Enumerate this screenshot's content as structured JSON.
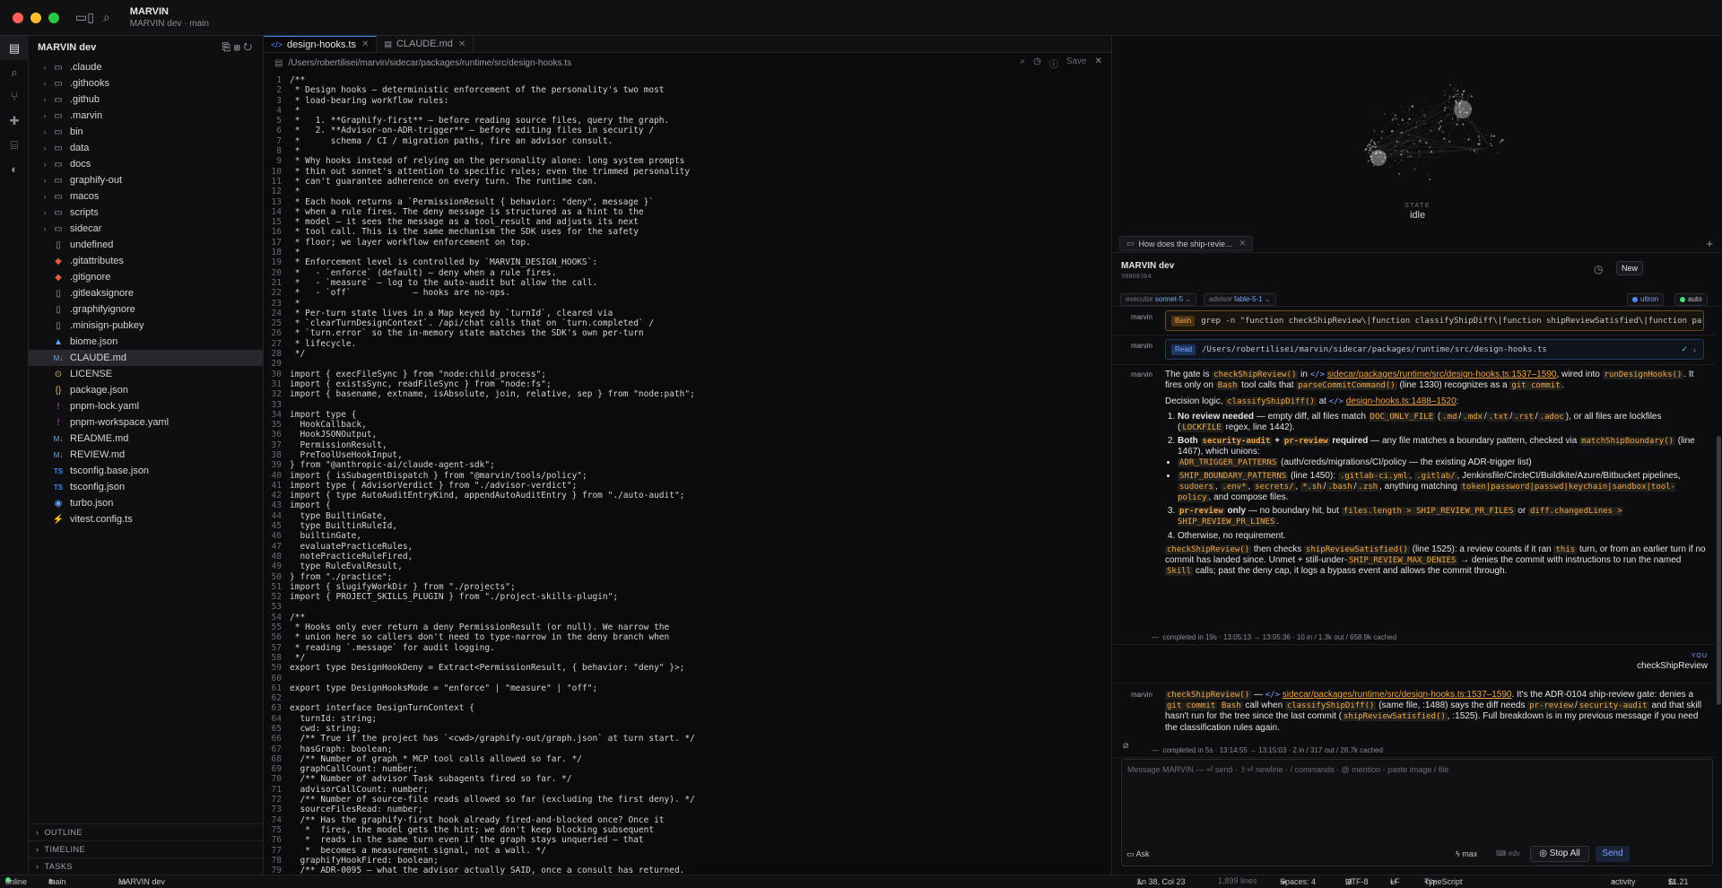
{
  "titlebar": {
    "title": "MARVIN",
    "subtitle": "MARVIN dev · main"
  },
  "explorer": {
    "title": "MARVIN dev",
    "items": [
      {
        "name": ".claude",
        "kind": "folder"
      },
      {
        "name": ".githooks",
        "kind": "folder"
      },
      {
        "name": ".github",
        "kind": "folder"
      },
      {
        "name": ".marvin",
        "kind": "folder"
      },
      {
        "name": "bin",
        "kind": "folder"
      },
      {
        "name": "data",
        "kind": "folder"
      },
      {
        "name": "docs",
        "kind": "folder"
      },
      {
        "name": "graphify-out",
        "kind": "folder"
      },
      {
        "name": "macos",
        "kind": "folder"
      },
      {
        "name": "scripts",
        "kind": "folder"
      },
      {
        "name": "sidecar",
        "kind": "folder"
      },
      {
        "name": "undefined",
        "kind": "file"
      },
      {
        "name": ".gitattributes",
        "kind": "git"
      },
      {
        "name": ".gitignore",
        "kind": "git"
      },
      {
        "name": ".gitleaksignore",
        "kind": "file"
      },
      {
        "name": ".graphifyignore",
        "kind": "file"
      },
      {
        "name": ".minisign-pubkey",
        "kind": "file"
      },
      {
        "name": "biome.json",
        "kind": "biome"
      },
      {
        "name": "CLAUDE.md",
        "kind": "md",
        "selected": true
      },
      {
        "name": "LICENSE",
        "kind": "lic"
      },
      {
        "name": "package.json",
        "kind": "json"
      },
      {
        "name": "pnpm-lock.yaml",
        "kind": "yaml"
      },
      {
        "name": "pnpm-workspace.yaml",
        "kind": "yaml"
      },
      {
        "name": "README.md",
        "kind": "md"
      },
      {
        "name": "REVIEW.md",
        "kind": "md"
      },
      {
        "name": "tsconfig.base.json",
        "kind": "ts"
      },
      {
        "name": "tsconfig.json",
        "kind": "ts"
      },
      {
        "name": "turbo.json",
        "kind": "turbo"
      },
      {
        "name": "vitest.config.ts",
        "kind": "vit"
      }
    ],
    "sections": [
      "OUTLINE",
      "TIMELINE",
      "TASKS"
    ]
  },
  "editor": {
    "tabs": [
      {
        "label": "design-hooks.ts"
      },
      {
        "label": "CLAUDE.md"
      }
    ],
    "path": "/Users/robertilisei/marvin/sidecar/packages/runtime/src/design-hooks.ts",
    "save_label": "Save",
    "lines": [
      "/**",
      " * Design hooks — deterministic enforcement of the personality's two most",
      " * load-bearing workflow rules:",
      " *",
      " *   1. **Graphify-first** — before reading source files, query the graph.",
      " *   2. **Advisor-on-ADR-trigger** — before editing files in security /",
      " *      schema / CI / migration paths, fire an advisor consult.",
      " *",
      " * Why hooks instead of relying on the personality alone: long system prompts",
      " * thin out sonnet's attention to specific rules; even the trimmed personality",
      " * can't guarantee adherence on every turn. The runtime can.",
      " *",
      " * Each hook returns a `PermissionResult { behavior: \"deny\", message }`",
      " * when a rule fires. The deny message is structured as a hint to the",
      " * model — it sees the message as a tool_result and adjusts its next",
      " * tool call. This is the same mechanism the SDK uses for the safety",
      " * floor; we layer workflow enforcement on top.",
      " *",
      " * Enforcement level is controlled by `MARVIN_DESIGN_HOOKS`:",
      " *   - `enforce` (default) — deny when a rule fires.",
      " *   - `measure` — log to the auto-audit but allow the call.",
      " *   - `off`            — hooks are no-ops.",
      " *",
      " * Per-turn state lives in a Map keyed by `turnId`, cleared via",
      " * `clearTurnDesignContext`. /api/chat calls that on `turn.completed` /",
      " * `turn.error` so the in-memory state matches the SDK's own per-turn",
      " * lifecycle.",
      " */",
      "",
      "import { execFileSync } from \"node:child_process\";",
      "import { existsSync, readFileSync } from \"node:fs\";",
      "import { basename, extname, isAbsolute, join, relative, sep } from \"node:path\";",
      "",
      "import type {",
      "  HookCallback,",
      "  HookJSONOutput,",
      "  PermissionResult,",
      "  PreToolUseHookInput,",
      "} from \"@anthropic-ai/claude-agent-sdk\";",
      "import { isSubagentDispatch } from \"@marvin/tools/policy\";",
      "import type { AdvisorVerdict } from \"./advisor-verdict\";",
      "import { type AutoAuditEntryKind, appendAutoAuditEntry } from \"./auto-audit\";",
      "import {",
      "  type BuiltinGate,",
      "  type BuiltinRuleId,",
      "  builtinGate,",
      "  evaluatePracticeRules,",
      "  notePracticeRuleFired,",
      "  type RuleEvalResult,",
      "} from \"./practice\";",
      "import { slugifyWorkDir } from \"./projects\";",
      "import { PROJECT_SKILLS_PLUGIN } from \"./project-skills-plugin\";",
      "",
      "/**",
      " * Hooks only ever return a deny PermissionResult (or null). We narrow the",
      " * union here so callers don't need to type-narrow in the deny branch when",
      " * reading `.message` for audit logging.",
      " */",
      "export type DesignHookDeny = Extract<PermissionResult, { behavior: \"deny\" }>;",
      "",
      "export type DesignHooksMode = \"enforce\" | \"measure\" | \"off\";",
      "",
      "export interface DesignTurnContext {",
      "  turnId: string;",
      "  cwd: string;",
      "  /** True if the project has `<cwd>/graphify-out/graph.json` at turn start. */",
      "  hasGraph: boolean;",
      "  /** Number of graph_* MCP tool calls allowed so far. */",
      "  graphCallCount: number;",
      "  /** Number of advisor Task subagents fired so far. */",
      "  advisorCallCount: number;",
      "  /** Number of source-file reads allowed so far (excluding the first deny). */",
      "  sourceFilesRead: number;",
      "  /** Has the graphify-first hook already fired-and-blocked once? Once it",
      "   *  fires, the model gets the hint; we don't keep blocking subsequent",
      "   *  reads in the same turn even if the graph stays unqueried — that",
      "   *  becomes a measurement signal, not a wall. */",
      "  graphifyHookFired: boolean;",
      "  /** ADR-0095 — what the advisor actually SAID, once a consult has returned."
    ]
  },
  "right": {
    "state_label": "STATE",
    "state_value": "idle",
    "chat_tab": "How does the ship-revie...",
    "session_name": "MARVIN dev",
    "session_id": "988083b4",
    "new_label": "New",
    "executor_label": "executor",
    "executor_value": "sonnet-5",
    "advisor_label": "advisor",
    "advisor_value": "fable-5-1",
    "ultron_label": "ultron",
    "auto_label": "auto",
    "author": "marvin",
    "bash_tag": "Bash",
    "bash_cmd": "grep -n \"function checkShipReview\\|function classifyShipDiff\\|function shipReviewSatisfied\\|function parseCo…",
    "read_tag": "Read",
    "read_path": "/Users/robertilisei/marvin/sidecar/packages/runtime/src/design-hooks.ts",
    "meta1": "completed in 19s · 13:05:13 → 13:05:36 · 10 in / 1.3k out / 658.9k cached",
    "you_label": "YOU",
    "you_text": "checkShipReview",
    "meta2": "completed in 5s · 13:14:55 → 13:15:03 · 2 in / 317 out / 28.7k cached",
    "placeholder": "Message MARVIN — ⏎ send · ⇧⏎ newline · / commands · @ mention · paste image / file",
    "ask_label": "Ask",
    "max_label": "max",
    "edv_label": "edv",
    "stop_label": "Stop All",
    "send_label": "Send"
  },
  "status": {
    "online": "online",
    "branch": "main",
    "workspace": "MARVIN dev",
    "position": "Ln 38, Col 23",
    "lines": "1,899 lines",
    "spaces": "Spaces: 4",
    "encoding": "UTF-8",
    "eol": "LF",
    "language": "TypeScript",
    "activity": "activity",
    "cost": "$1.21"
  },
  "colors": {
    "accent": "#4f8cff",
    "orange": "#f0a54a",
    "online": "#4ade80"
  }
}
